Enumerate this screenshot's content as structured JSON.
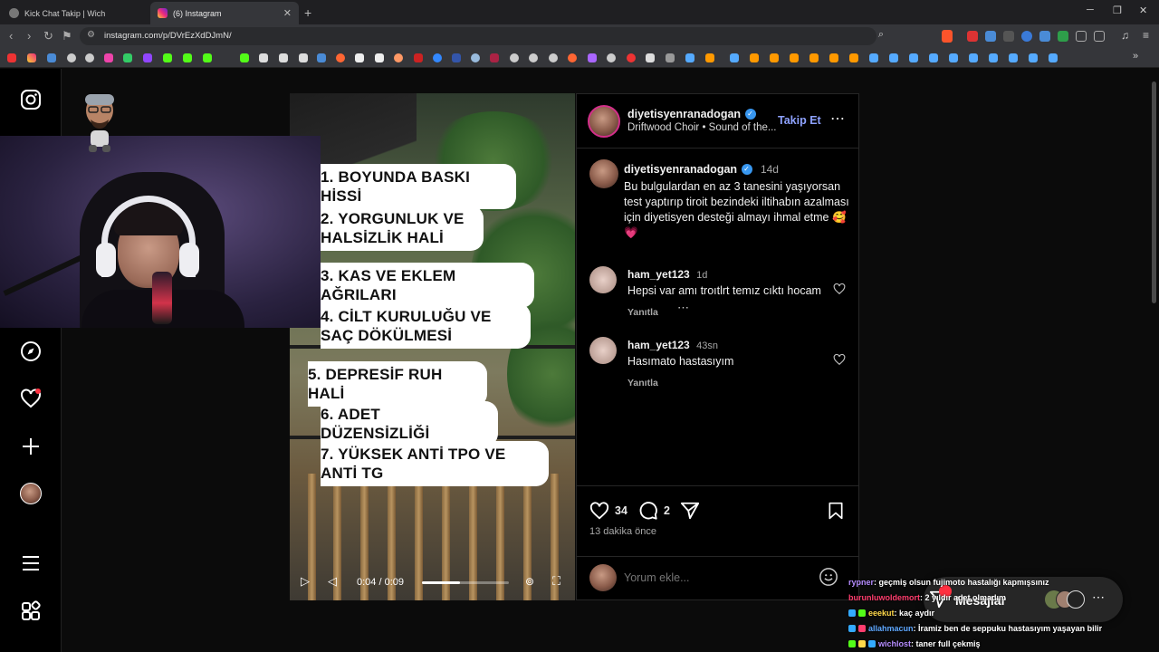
{
  "browser": {
    "tabs": [
      {
        "title": "Kick Chat Takip | Wich",
        "active": false
      },
      {
        "title": "(6) Instagram",
        "active": true
      }
    ],
    "url": "instagram.com/p/DVrEzXdDJmN/",
    "colors": {
      "tabbar": "#1f1f22",
      "toolbar": "#35363a",
      "accent_brave": "#fb542b"
    }
  },
  "sidebar": {
    "items": [
      {
        "icon": "instagram-logo-icon"
      },
      {
        "icon": "explore-compass-icon"
      },
      {
        "icon": "notifications-heart-icon",
        "has_dot": true
      },
      {
        "icon": "create-plus-icon"
      },
      {
        "icon": "profile-avatar-icon"
      },
      {
        "icon": "more-menu-icon"
      },
      {
        "icon": "also-from-meta-icon"
      }
    ]
  },
  "post": {
    "overlay_lines": [
      "1. BOYUNDA BASKI HİSSİ",
      "2. YORGUNLUK VE HALSİZLİK HALİ",
      "3. KAS VE EKLEM AĞRILARI",
      "4. CİLT KURULUĞU VE SAÇ DÖKÜLMESİ",
      "5. DEPRESİF RUH HALİ",
      "6. ADET DÜZENSİZLİĞİ",
      "7. YÜKSEK ANTİ TPO VE ANTİ TG"
    ],
    "video_time": "0:04 / 0:09",
    "video_progress": 0.44,
    "author": "diyetisyenranadogan",
    "audio": "Driftwood Choir • Sound of the...",
    "follow_label": "Takip Et",
    "caption": {
      "user": "diyetisyenranadogan",
      "age": "14d",
      "text": "Bu bulgulardan en az 3 tanesini yaşıyorsan test yaptırıp tiroit bezindeki iltihabın azalması için diyetisyen desteği almayı ihmal etme 🥰💗"
    },
    "comments": [
      {
        "user": "ham_yet123",
        "age": "1d",
        "text": "Hepsi var amı troıtlrt temız cıktı hocam",
        "reply": "Yanıtla"
      },
      {
        "user": "ham_yet123",
        "age": "43sn",
        "text": "Hasımato hastasıyım",
        "reply": "Yanıtla"
      }
    ],
    "likes": "34",
    "comment_count": "2",
    "posted": "13 dakika önce",
    "comment_placeholder": "Yorum ekle..."
  },
  "messages_button": {
    "label": "Mesajlar"
  },
  "chat": [
    {
      "user": "rypner",
      "text": " : geçmiş olsun fujimoto hastalığı kapmışsınız",
      "color": "#b58cff"
    },
    {
      "user": "burunluwoldemort",
      "text": " : 2 yıldır adet olmadım",
      "color": "#ff3d6e"
    },
    {
      "user": "eeekut",
      "text": " : kaç aydır",
      "color": "#ffd84a"
    },
    {
      "user": "allahmacun",
      "text": " : İramiz ben de seppuku hastasıyım yaşayan bilir",
      "color": "#5fa8ff"
    },
    {
      "user": "wichlost",
      "text": " : taner full çekmiş",
      "color": "#b58cff"
    }
  ]
}
